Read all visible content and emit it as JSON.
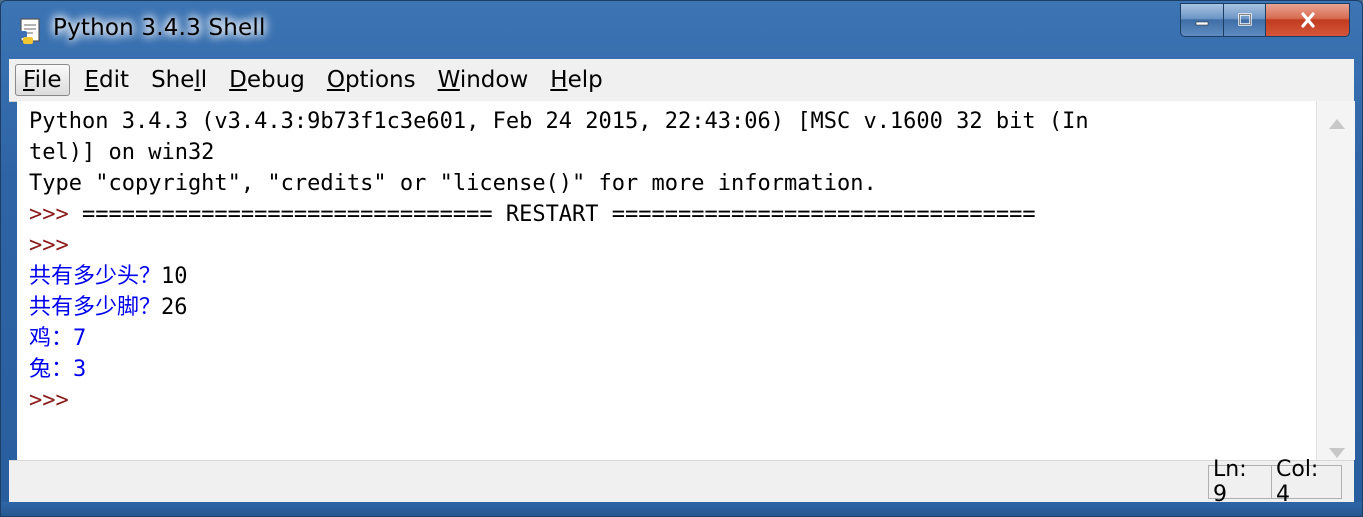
{
  "window": {
    "title": "Python 3.4.3 Shell"
  },
  "menu": [
    {
      "label": "File",
      "accel_index": 0
    },
    {
      "label": "Edit",
      "accel_index": 0
    },
    {
      "label": "Shell",
      "accel_index": 3
    },
    {
      "label": "Debug",
      "accel_index": 0
    },
    {
      "label": "Options",
      "accel_index": 0
    },
    {
      "label": "Window",
      "accel_index": 0
    },
    {
      "label": "Help",
      "accel_index": 0
    }
  ],
  "shell": {
    "lines": [
      {
        "text": "Python 3.4.3 (v3.4.3:9b73f1c3e601, Feb 24 2015, 22:43:06) [MSC v.1600 32 bit (In",
        "style": "black"
      },
      {
        "text": "tel)] on win32",
        "style": "black"
      },
      {
        "text": "Type \"copyright\", \"credits\" or \"license()\" for more information.",
        "style": "black"
      },
      {
        "prompt": ">>> ",
        "text": "=============================== RESTART ================================",
        "style": "black"
      },
      {
        "prompt": ">>>",
        "text": "",
        "style": "black"
      },
      {
        "text": "共有多少头？",
        "input": "10",
        "style": "blue"
      },
      {
        "text": "共有多少脚？",
        "input": "26",
        "style": "blue"
      },
      {
        "text": "鸡：7",
        "style": "blue"
      },
      {
        "text": "兔：3",
        "style": "blue"
      },
      {
        "prompt": ">>>",
        "text": "",
        "style": "black"
      }
    ]
  },
  "status": {
    "line": "Ln: 9",
    "col": "Col: 4"
  },
  "colors": {
    "prompt": "#8b1a1a",
    "output": "#0000f0",
    "text": "#000000"
  },
  "icons": {
    "app": "python-idle-icon",
    "minimize": "minimize-icon",
    "maximize": "maximize-icon",
    "close": "close-icon"
  }
}
